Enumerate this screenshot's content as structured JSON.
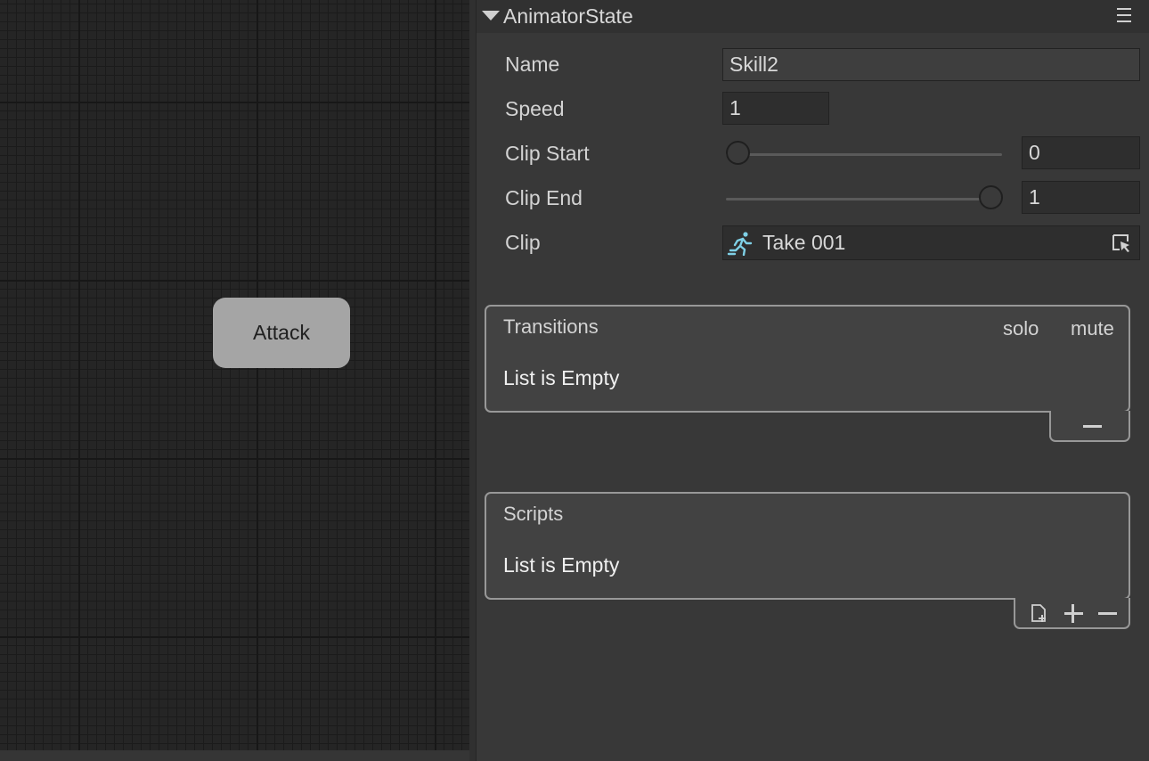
{
  "canvas": {
    "node_label": "Attack"
  },
  "inspector": {
    "header_title": "AnimatorState",
    "labels": {
      "name": "Name",
      "speed": "Speed",
      "clip_start": "Clip Start",
      "clip_end": "Clip End",
      "clip": "Clip"
    },
    "values": {
      "name": "Skill2",
      "speed": "1",
      "clip_start": "0",
      "clip_end": "1",
      "clip": "Take 001"
    },
    "sliders": {
      "clip_start_fraction": 0,
      "clip_end_fraction": 1
    },
    "icons": {
      "header_fold": "triangle-down-icon",
      "menu": "menu-icon",
      "clip": "running-figure-icon",
      "picker": "cursor-picker-icon"
    },
    "clip_icon_color": "#7fd0e6"
  },
  "transitions": {
    "title": "Transitions",
    "col_solo": "solo",
    "col_mute": "mute",
    "empty_text": "List is Empty"
  },
  "scripts": {
    "title": "Scripts",
    "empty_text": "List is Empty"
  }
}
